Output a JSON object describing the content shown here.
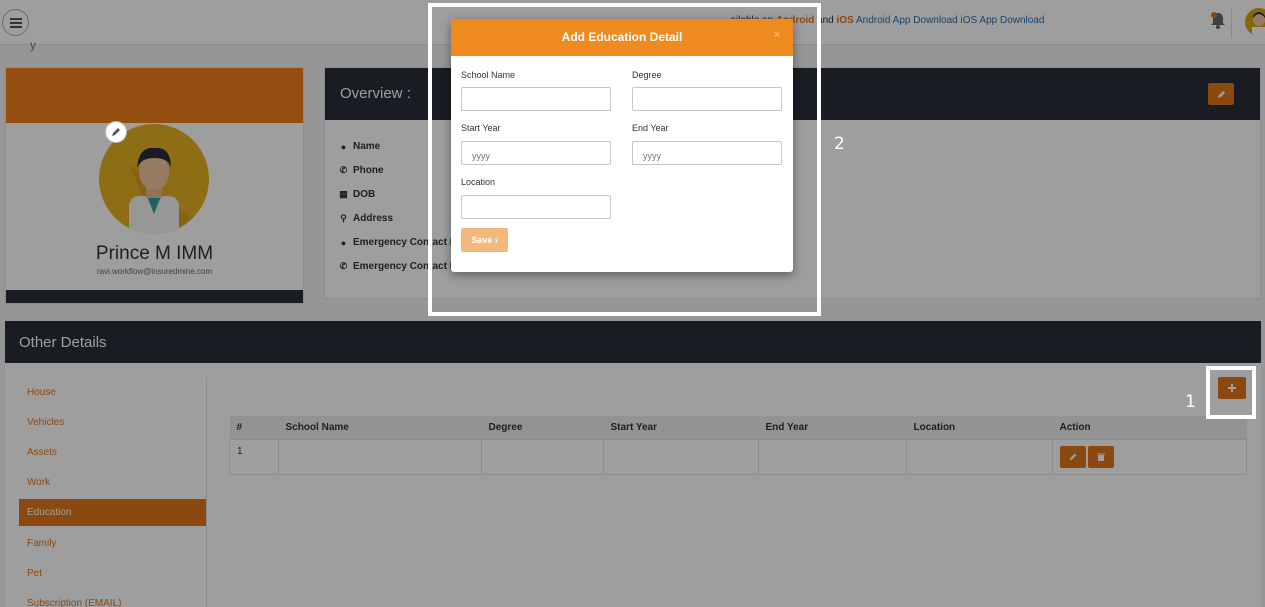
{
  "topbar": {
    "app_text_pre": "...ailable on ",
    "android": "Android",
    "and": " and ",
    "ios": "iOS",
    "android_img": "Android App Download",
    "ios_img": "iOS App Download",
    "icons": [
      "menu-icon",
      "bell-icon",
      "avatar"
    ]
  },
  "profile": {
    "name": "Prince M IMM",
    "email": "ravi.workflow@insuredmine.com"
  },
  "overview": {
    "title": "Overview :",
    "fields": [
      "Name",
      "Phone",
      "DOB",
      "Address",
      "Emergency Contact N",
      "Emergency Contact N"
    ]
  },
  "other": {
    "title": "Other Details",
    "sidebar": [
      "House",
      "Vehicles",
      "Assets",
      "Work",
      "Education",
      "Family",
      "Pet",
      "Subscription (EMAIL)"
    ],
    "active": "Education",
    "table": {
      "headers": [
        "#",
        "School Name",
        "Degree",
        "Start Year",
        "End Year",
        "Location",
        "Action"
      ],
      "rows": [
        [
          "1",
          "",
          "",
          "",
          "",
          ""
        ]
      ]
    }
  },
  "modal": {
    "title": "Add Education Detail",
    "close": "×",
    "labels": {
      "school": "School Name",
      "degree": "Degree",
      "start": "Start Year",
      "end": "End Year",
      "location": "Location"
    },
    "placeholders": {
      "start": "yyyy",
      "end": "yyyy"
    },
    "save": "Save ›"
  },
  "annotations": {
    "one": "1",
    "two": "2"
  },
  "colors": {
    "accent": "#e0761a",
    "dark": "#2b2e3b",
    "modal_header": "#ef8a1e"
  }
}
